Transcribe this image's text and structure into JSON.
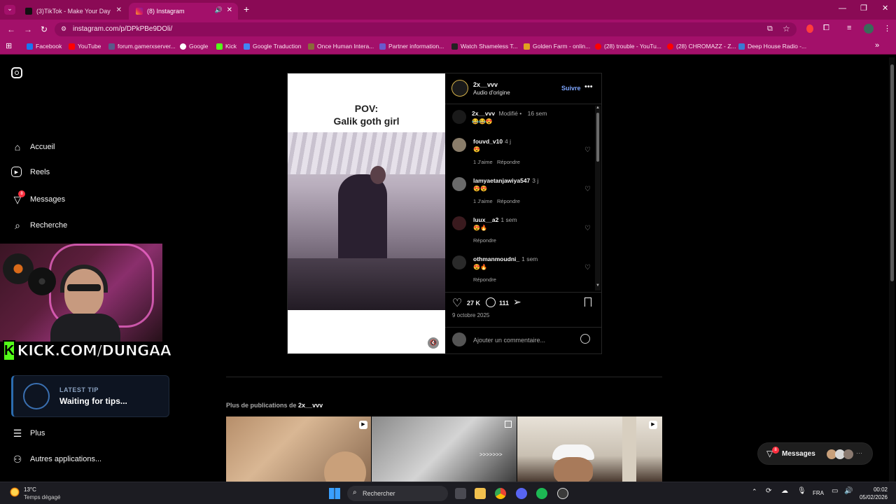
{
  "browser": {
    "tabs": [
      {
        "label": "(3)TikTok - Make Your Day"
      },
      {
        "label": "(8) Instagram"
      }
    ],
    "url": "instagram.com/p/DPkPBe9DOli/",
    "bookmarks": [
      {
        "label": "Facebook",
        "color": "#1877f2"
      },
      {
        "label": "YouTube",
        "color": "#ff0000"
      },
      {
        "label": "forum.gamerxserver...",
        "color": "#5a5a8a"
      },
      {
        "label": "Google",
        "color": "#ffffff"
      },
      {
        "label": "Kick",
        "color": "#53fc18"
      },
      {
        "label": "Google Traduction",
        "color": "#4285f4"
      },
      {
        "label": "Once Human Intera...",
        "color": "#8a6a3a"
      },
      {
        "label": "Partner information...",
        "color": "#6a5acd"
      },
      {
        "label": "Watch Shameless T...",
        "color": "#222222"
      },
      {
        "label": "Golden Farm - onlin...",
        "color": "#e0a020"
      },
      {
        "label": "(28) trouble - YouTu...",
        "color": "#ff0000"
      },
      {
        "label": "(28) CHROMAZZ - Z...",
        "color": "#ff0000"
      },
      {
        "label": "Deep House Radio -...",
        "color": "#3a7bd5"
      }
    ]
  },
  "sidebar": {
    "items": [
      {
        "label": "Accueil",
        "icon": "home-icon"
      },
      {
        "label": "Reels",
        "icon": "reels-icon"
      },
      {
        "label": "Messages",
        "icon": "messages-icon",
        "badge": "8"
      },
      {
        "label": "Recherche",
        "icon": "search-icon"
      }
    ],
    "more": "Plus",
    "apps": "Autres applications..."
  },
  "stream": {
    "kick": "KICK.COM/DUNGAA",
    "tip_title": "LATEST TIP",
    "tip_text": "Waiting for tips..."
  },
  "post": {
    "caption_line1": "POV:",
    "caption_line2": "Galik goth girl",
    "author": "2x__vvv",
    "audio": "Audio d'origine",
    "follow": "Suivre",
    "owner_comment": {
      "name": "2x__vvv",
      "edited": "Modifié •",
      "time": "16 sem",
      "emoji": "😂😂😍"
    },
    "comments": [
      {
        "name": "fouvd_v10",
        "time": "4 j",
        "emoji": "😍",
        "likes": "1 J'aime",
        "reply": "Répondre"
      },
      {
        "name": "lamyaetanjawiya547",
        "time": "3 j",
        "emoji": "😍😍",
        "likes": "1 J'aime",
        "reply": "Répondre"
      },
      {
        "name": "luux__a2",
        "time": "1 sem",
        "emoji": "😍🔥",
        "likes": "",
        "reply": "Répondre"
      },
      {
        "name": "othmanmoudni_",
        "time": "1 sem",
        "emoji": "😍🔥",
        "likes": "",
        "reply": "Répondre"
      }
    ],
    "likes": "27 K",
    "comments_count": "111",
    "date": "9 octobre 2025",
    "add_comment_placeholder": "Ajouter un commentaire..."
  },
  "more_posts": {
    "prefix": "Plus de publications de",
    "user": "2x__vvv",
    "thumb2_text": ">>>>>>>"
  },
  "messages_fab": {
    "label": "Messages",
    "badge": "8"
  },
  "taskbar": {
    "weather_temp": "13°C",
    "weather_desc": "Temps dégagé",
    "search": "Rechercher",
    "lang": "FRA",
    "time": "00:02",
    "date": "05/02/2026"
  }
}
